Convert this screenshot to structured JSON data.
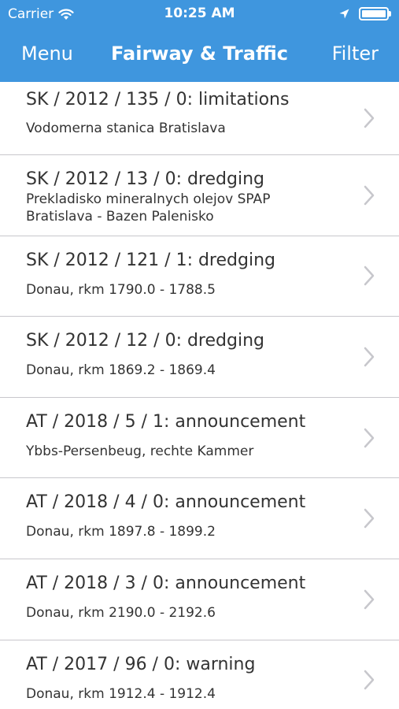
{
  "status_bar": {
    "carrier": "Carrier",
    "time": "10:25 AM",
    "icons": [
      "wifi-icon",
      "location-arrow-icon",
      "battery-icon"
    ]
  },
  "nav": {
    "left_label": "Menu",
    "title": "Fairway & Traffic",
    "right_label": "Filter"
  },
  "colors": {
    "header_background": "#3f96de",
    "header_text": "#ffffff",
    "separator": "#c8c7cc",
    "chevron": "#c7c7cc"
  },
  "items": [
    {
      "title": "SK / 2012 / 135 / 0: limitations",
      "subtitle": "Vodomerna stanica Bratislava"
    },
    {
      "title": "SK / 2012 / 13 / 0: dredging",
      "subtitle": "Prekladisko mineralnych olejov SPAP Bratislava - Bazen Palenisko"
    },
    {
      "title": "SK / 2012 / 121 / 1: dredging",
      "subtitle": "Donau, rkm 1790.0 - 1788.5"
    },
    {
      "title": "SK / 2012 / 12 / 0: dredging",
      "subtitle": "Donau, rkm 1869.2 - 1869.4"
    },
    {
      "title": "AT / 2018 / 5 / 1: announcement",
      "subtitle": "Ybbs-Persenbeug, rechte Kammer"
    },
    {
      "title": "AT / 2018 / 4 / 0: announcement",
      "subtitle": "Donau, rkm 1897.8 - 1899.2"
    },
    {
      "title": "AT / 2018 / 3 / 0: announcement",
      "subtitle": "Donau, rkm 2190.0 - 2192.6"
    },
    {
      "title": "AT / 2017 / 96 / 0: warning",
      "subtitle": "Donau, rkm 1912.4 - 1912.4"
    }
  ]
}
